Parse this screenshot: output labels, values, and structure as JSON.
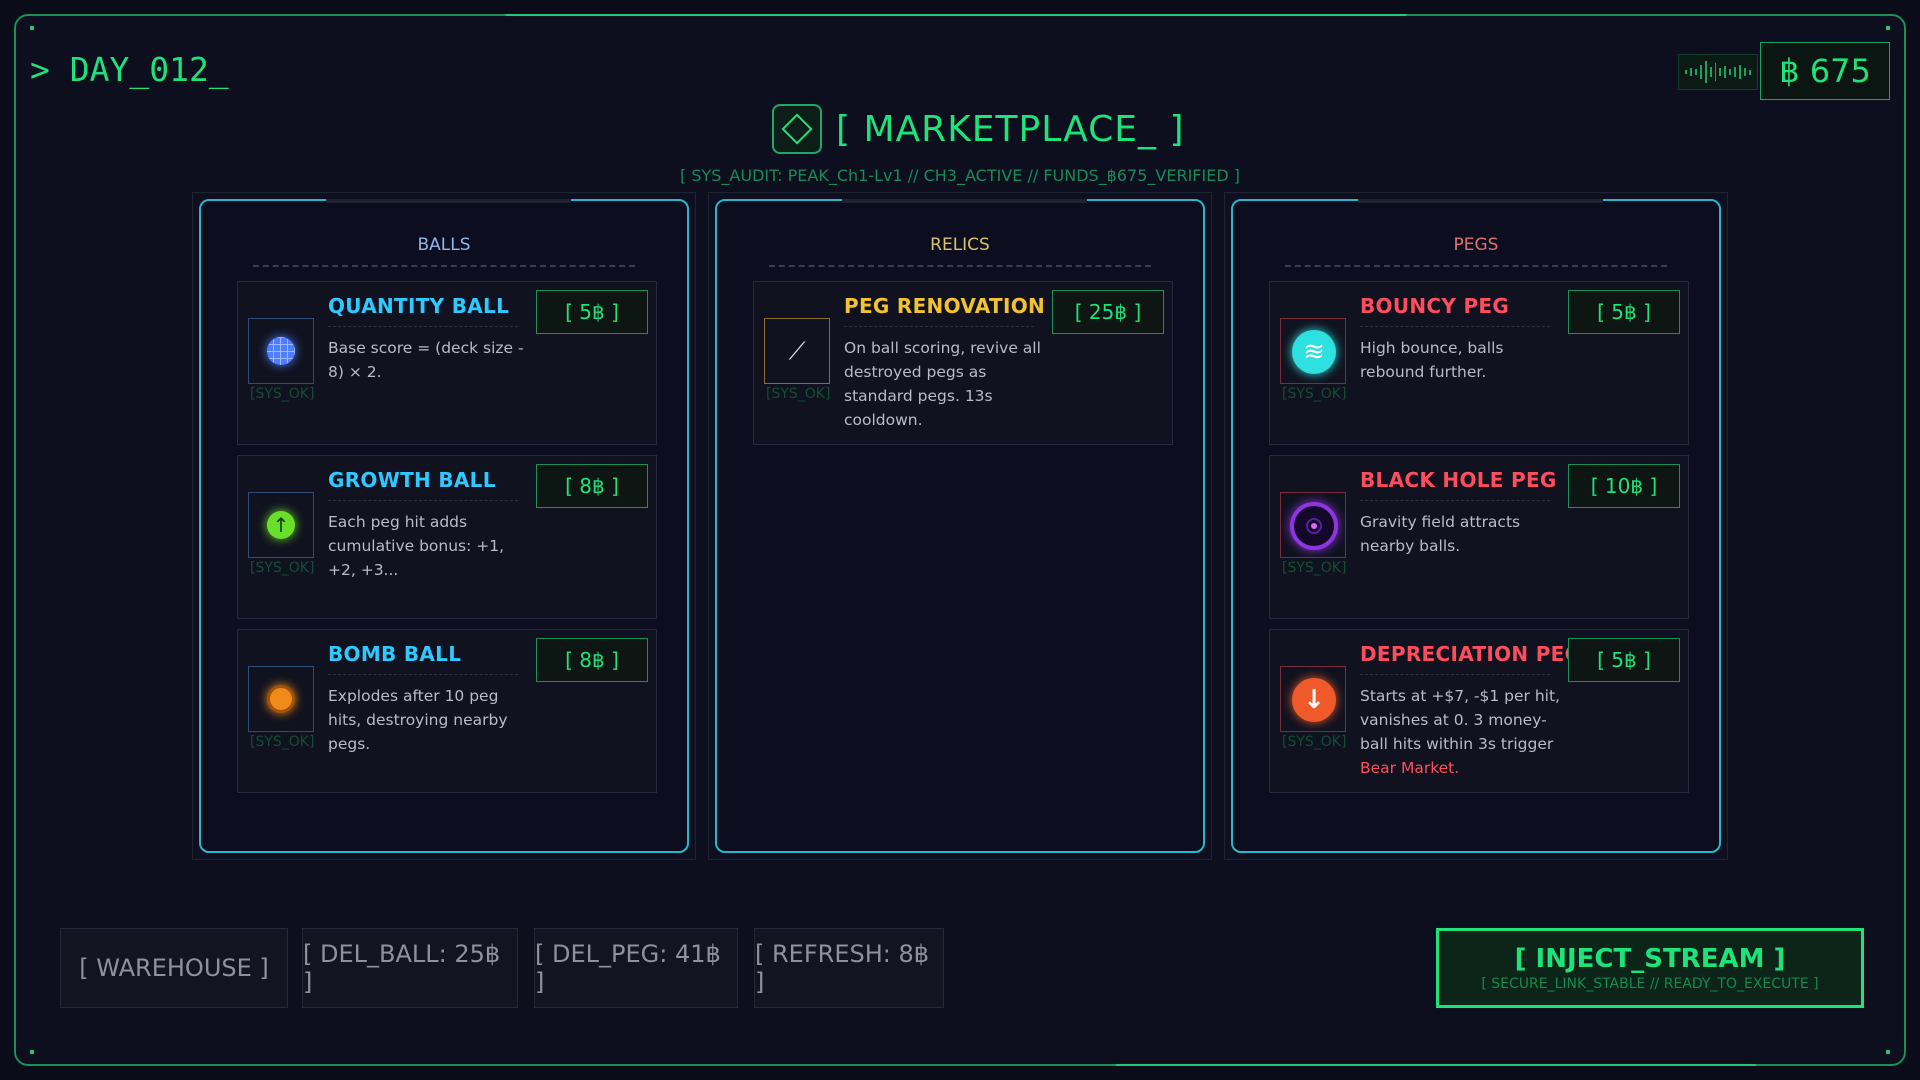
{
  "header": {
    "day": "> DAY_012_",
    "funds": "฿ 675"
  },
  "market": {
    "title": "[ MARKETPLACE_ ]",
    "audit": "[ SYS_AUDIT: PEAK_Ch1-Lv1 // CH3_ACTIVE // FUNDS_฿675_VERIFIED ]"
  },
  "panels": [
    {
      "title": "BALLS",
      "color": "#8fb8e6",
      "items": [
        {
          "name": "QUANTITY BALL",
          "price": "[ 5฿ ]",
          "desc": "Base score = (deck size - 8) × 2.",
          "sys": "[SYS_OK]",
          "icon": "grid-ball-icon",
          "name_color": "#2fc8ff",
          "icon_color": "#4f7fff"
        },
        {
          "name": "GROWTH BALL",
          "price": "[ 8฿ ]",
          "desc": "Each peg hit adds cumulative bonus: +1, +2, +3...",
          "sys": "[SYS_OK]",
          "icon": "arrow-up-ball-icon",
          "name_color": "#2fc8ff",
          "icon_color": "#6adf2a"
        },
        {
          "name": "BOMB BALL",
          "price": "[ 8฿ ]",
          "desc": "Explodes after 10 peg hits, destroying nearby pegs.",
          "sys": "[SYS_OK]",
          "icon": "bomb-ball-icon",
          "name_color": "#2fc8ff",
          "icon_color": "#f08b1a"
        }
      ]
    },
    {
      "title": "RELICS",
      "color": "#d9c36a",
      "items": [
        {
          "name": "PEG RENOVATION",
          "price": "[ 25฿ ]",
          "desc": "On ball scoring, revive all destroyed pegs as standard pegs. 13s cooldown.",
          "sys": "[SYS_OK]",
          "icon": "wrench-relic-icon",
          "name_color": "#f2c230",
          "icon_color": "#c2a14a"
        }
      ]
    },
    {
      "title": "PEGS",
      "color": "#e07070",
      "items": [
        {
          "name": "BOUNCY PEG",
          "price": "[ 5฿ ]",
          "desc": "High bounce, balls rebound further.",
          "sys": "[SYS_OK]",
          "icon": "spring-peg-icon",
          "name_color": "#ff4d5e",
          "icon_color": "#2ee0e0"
        },
        {
          "name": "BLACK HOLE PEG",
          "price": "[ 10฿ ]",
          "desc": "Gravity field attracts nearby balls.",
          "sys": "[SYS_OK]",
          "icon": "black-hole-peg-icon",
          "name_color": "#ff4d5e",
          "icon_color": "#8e34e0"
        },
        {
          "name": "DEPRECIATION PEG",
          "price": "[ 5฿ ]",
          "desc": "Starts at +$7, -$1 per hit, vanishes at 0. 3 money-ball hits within 3s trigger",
          "desc_highlight": "Bear Market.",
          "sys": "[SYS_OK]",
          "icon": "down-arrow-peg-icon",
          "name_color": "#ff4d5e",
          "icon_color": "#f05a2a"
        }
      ]
    }
  ],
  "actions": {
    "warehouse": "[ WAREHOUSE ]",
    "del_ball": "[ DEL_BALL: 25฿ ]",
    "del_peg": "[ DEL_PEG: 41฿ ]",
    "refresh": "[ REFRESH: 8฿ ]",
    "inject": "[ INJECT_STREAM ]",
    "inject_sub": "[ SECURE_LINK_STABLE // READY_TO_EXECUTE ]"
  },
  "colors": {
    "accent": "#1ee27a",
    "panel_border": "#27b7c9",
    "danger": "#ff4d5e"
  }
}
